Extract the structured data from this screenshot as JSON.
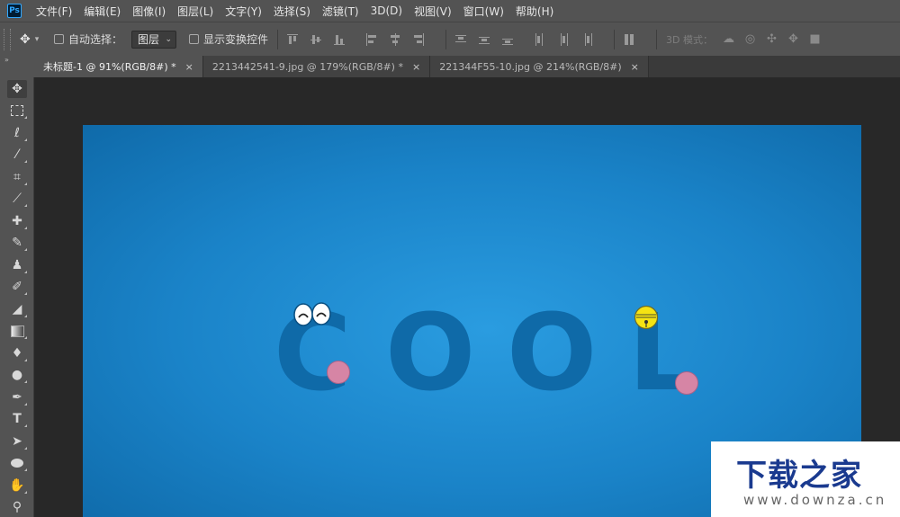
{
  "app": {
    "logo": "Ps"
  },
  "menu": [
    "文件(F)",
    "编辑(E)",
    "图像(I)",
    "图层(L)",
    "文字(Y)",
    "选择(S)",
    "滤镜(T)",
    "3D(D)",
    "视图(V)",
    "窗口(W)",
    "帮助(H)"
  ],
  "options": {
    "auto_select_label": "自动选择：",
    "layer_select_value": "图层",
    "show_transform_label": "显示变换控件",
    "mode_label": "3D 模式："
  },
  "tabs": [
    {
      "label": "未标题-1 @ 91%(RGB/8#) *",
      "close": "×"
    },
    {
      "label": "2213442541-9.jpg @ 179%(RGB/8#) *",
      "close": "×"
    },
    {
      "label": "221344F55-10.jpg @ 214%(RGB/8#)",
      "close": "×"
    }
  ],
  "panel_toggle": "»",
  "tools": [
    "move-tool-icon",
    "marquee-tool-icon",
    "lasso-tool-icon",
    "magic-wand-icon",
    "crop-tool-icon",
    "eyedropper-icon",
    "healing-brush-icon",
    "brush-tool-icon",
    "clone-stamp-icon",
    "history-brush-icon",
    "eraser-icon",
    "gradient-tool-icon",
    "blur-tool-icon",
    "dodge-tool-icon",
    "pen-tool-icon",
    "type-tool-icon",
    "path-select-icon",
    "ellipse-tool-icon",
    "hand-tool-icon",
    "zoom-tool-icon"
  ],
  "artwork": {
    "letters": [
      "C",
      "O",
      "O",
      "L"
    ]
  },
  "watermark": {
    "title": "下载之家",
    "url": "www.downza.cn"
  },
  "colors": {
    "canvas_blue": "#1a83c8",
    "letter_blue": "#0f6aa8",
    "cheek_pink": "#d685a5",
    "bell_yellow": "#f5e313"
  }
}
